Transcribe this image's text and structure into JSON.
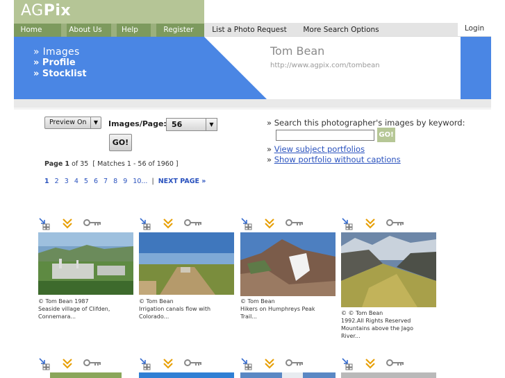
{
  "brand": {
    "logo_a": "AG",
    "logo_b": "Pix"
  },
  "nav": {
    "green": [
      "Home",
      "About Us",
      "Help",
      "Register"
    ],
    "grey": [
      "List a Photo Request",
      "More Search Options"
    ],
    "login": "Login"
  },
  "sidebar": {
    "items": [
      "» Images",
      "» Profile",
      "» Stocklist"
    ]
  },
  "photographer": {
    "name": "Tom Bean",
    "url": "http://www.agpix.com/tombean"
  },
  "controls": {
    "preview_label": "Preview On",
    "images_per_page_label": "Images/Page:",
    "images_per_page_value": "56",
    "go_label": "GO!"
  },
  "paging": {
    "page_word": "Page",
    "current": "1",
    "of_text": "of 35",
    "matches_text": "[ Matches 1 - 56 of 1960 ]",
    "pages": [
      "1",
      "2",
      "3",
      "4",
      "5",
      "6",
      "7",
      "8",
      "9",
      "10..."
    ],
    "separator": "|",
    "next_label": "NEXT PAGE »"
  },
  "search": {
    "label": "» Search this photographer's images by keyword:",
    "input_value": "",
    "go_label": "GO!",
    "link_prefix": "»",
    "subject_link": "View subject portfolios",
    "no_caption_link": "Show portfolio without captions"
  },
  "thumbnails": [
    {
      "credit": "© Tom Bean 1987",
      "caption": "Seaside village of Clifden, Connemara..."
    },
    {
      "credit": "© Tom Bean",
      "caption": "Irrigation canals flow with Colorado..."
    },
    {
      "credit": "© Tom Bean",
      "caption": "Hikers on Humphreys Peak Trail..."
    },
    {
      "credit": "© © Tom Bean",
      "caption": "1992.All Rights Reserved Mountains above the Jago River..."
    }
  ],
  "thumb_icons": [
    "lightbox-add-icon",
    "download-arrow-icon",
    "key-icon"
  ],
  "colors": {
    "blue": "#4a86e4",
    "green_dark": "#7d9a5e",
    "green_light": "#b5c596",
    "link": "#2a52be"
  }
}
